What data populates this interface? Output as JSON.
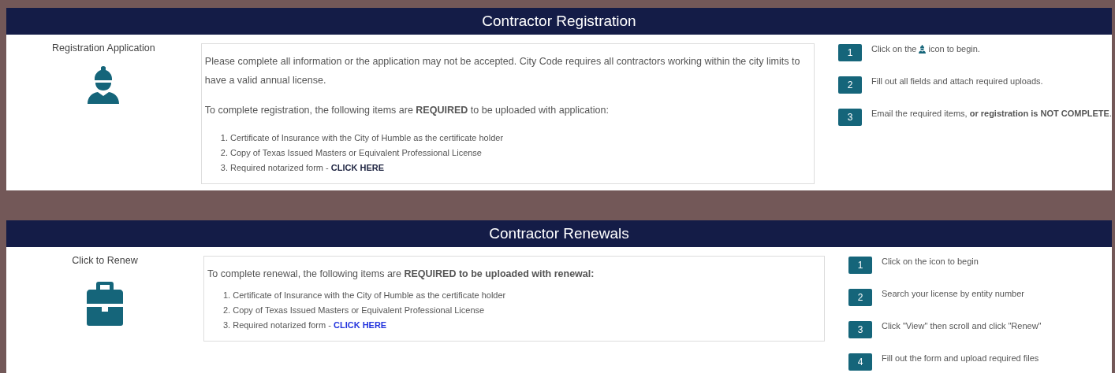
{
  "sections": [
    {
      "title": "Contractor Registration",
      "icon": {
        "kind": "worker",
        "label": "Registration Application"
      },
      "paragraphs": [
        "Please complete all information or the application may not be accepted. City Code requires all contractors working within the city limits to have a valid annual license.",
        "To complete registration, the following items are **REQUIRED** to be uploaded with application:"
      ],
      "items": [
        {
          "number": "1.",
          "text": "Certificate of Insurance with the City of Humble as the certificate holder"
        },
        {
          "number": "2.",
          "text": "Copy of Texas Issued Masters or Equivalent Professional License"
        },
        {
          "number": "3.",
          "text": "Required notarized form - ",
          "link": {
            "text": "CLICK HERE",
            "color": "#1d2340"
          }
        }
      ],
      "steps": [
        {
          "number": "1",
          "parts": [
            {
              "kind": "text",
              "text": "Click on the"
            },
            {
              "kind": "icon"
            },
            {
              "kind": "text",
              "text": "icon to begin."
            }
          ]
        },
        {
          "number": "2",
          "parts": [
            {
              "kind": "text",
              "text": "Fill out all fields and attach required uploads."
            }
          ]
        },
        {
          "number": "3",
          "parts": [
            {
              "kind": "text",
              "text": "Email the required items, **or registration is NOT COMPLETE**."
            }
          ]
        }
      ]
    },
    {
      "title": "Contractor Renewals",
      "icon": {
        "kind": "toolbox",
        "label": "Click to Renew"
      },
      "paragraphs": [
        "To complete renewal, the following items are **REQUIRED to be uploaded with renewal:**"
      ],
      "items": [
        {
          "number": "1.",
          "text": "Certificate of Insurance with the City of Humble as the certificate holder"
        },
        {
          "number": "2.",
          "text": "Copy of Texas Issued Masters or Equivalent Professional License"
        },
        {
          "number": "3.",
          "text": "Required notarized form - ",
          "link": {
            "text": "CLICK HERE",
            "color": "#2233dd"
          }
        }
      ],
      "steps": [
        {
          "number": "1",
          "parts": [
            {
              "kind": "text",
              "text": "Click on the icon to begin"
            }
          ]
        },
        {
          "number": "2",
          "parts": [
            {
              "kind": "text",
              "text": "Search your license by entity number"
            }
          ]
        },
        {
          "number": "3",
          "parts": [
            {
              "kind": "text",
              "text": "Click \"View\" then scroll and click \"Renew\""
            }
          ]
        },
        {
          "number": "4",
          "parts": [
            {
              "kind": "text",
              "text": "Fill out the form and upload required files"
            }
          ]
        }
      ]
    }
  ]
}
